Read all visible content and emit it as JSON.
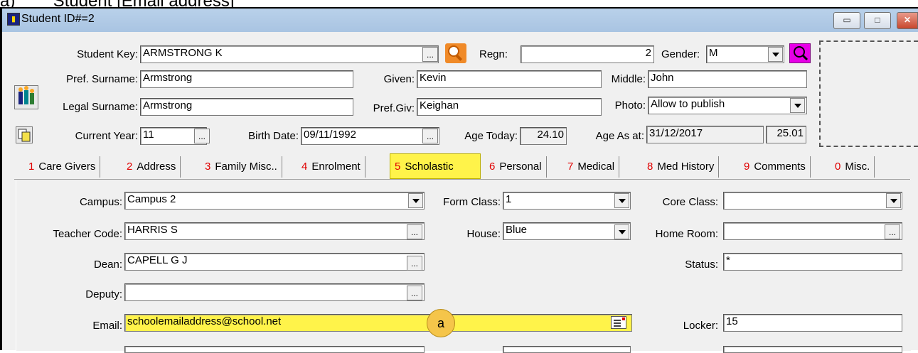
{
  "caption": "a)        Student [Email address]",
  "window": {
    "title": "Student ID#=2",
    "minimize": "▭",
    "maximize": "□",
    "close": "✕"
  },
  "header": {
    "student_key_label": "Student Key:",
    "student_key_value": "ARMSTRONG K",
    "regn_label": "Regn:",
    "regn_value": "2",
    "gender_label": "Gender:",
    "gender_value": "M",
    "pref_surname_label": "Pref. Surname:",
    "pref_surname_value": "Armstrong",
    "given_label": "Given:",
    "given_value": "Kevin",
    "middle_label": "Middle:",
    "middle_value": "John",
    "legal_surname_label": "Legal Surname:",
    "legal_surname_value": "Armstrong",
    "pref_giv_label": "Pref.Giv:",
    "pref_giv_value": "Keighan",
    "photo_label": "Photo:",
    "photo_value": "Allow to publish",
    "current_year_label": "Current Year:",
    "current_year_value": "11",
    "birth_date_label": "Birth Date:",
    "birth_date_value": "09/11/1992",
    "age_today_label": "Age Today:",
    "age_today_value": "24.10",
    "age_as_at_label": "Age As at:",
    "age_as_at_date": "31/12/2017",
    "age_as_at_value": "25.01",
    "dots": "..."
  },
  "tabs": [
    {
      "num": "1",
      "label": "Care Givers"
    },
    {
      "num": "2",
      "label": "Address"
    },
    {
      "num": "3",
      "label": "Family Misc.."
    },
    {
      "num": "4",
      "label": "Enrolment"
    },
    {
      "num": "5",
      "label": "Scholastic"
    },
    {
      "num": "6",
      "label": "Personal"
    },
    {
      "num": "7",
      "label": "Medical"
    },
    {
      "num": "8",
      "label": "Med History"
    },
    {
      "num": "9",
      "label": "Comments"
    },
    {
      "num": "0",
      "label": "Misc."
    }
  ],
  "scholastic": {
    "campus_label": "Campus:",
    "campus_value": "Campus 2",
    "form_class_label": "Form Class:",
    "form_class_value": "1",
    "core_class_label": "Core Class:",
    "core_class_value": "",
    "teacher_code_label": "Teacher Code:",
    "teacher_code_value": "HARRIS S",
    "house_label": "House:",
    "house_value": "Blue",
    "home_room_label": "Home Room:",
    "home_room_value": "",
    "dean_label": "Dean:",
    "dean_value": "CAPELL G J",
    "status_label": "Status:",
    "status_value": "*",
    "deputy_label": "Deputy:",
    "deputy_value": "",
    "email_label": "Email:",
    "email_value": "schoolemailaddress@school.net",
    "locker_label": "Locker:",
    "locker_value": "15",
    "callout": "a"
  },
  "colors": {
    "highlight": "#fff34a",
    "tab_number": "#e00000",
    "callout": "#f5c54a"
  }
}
